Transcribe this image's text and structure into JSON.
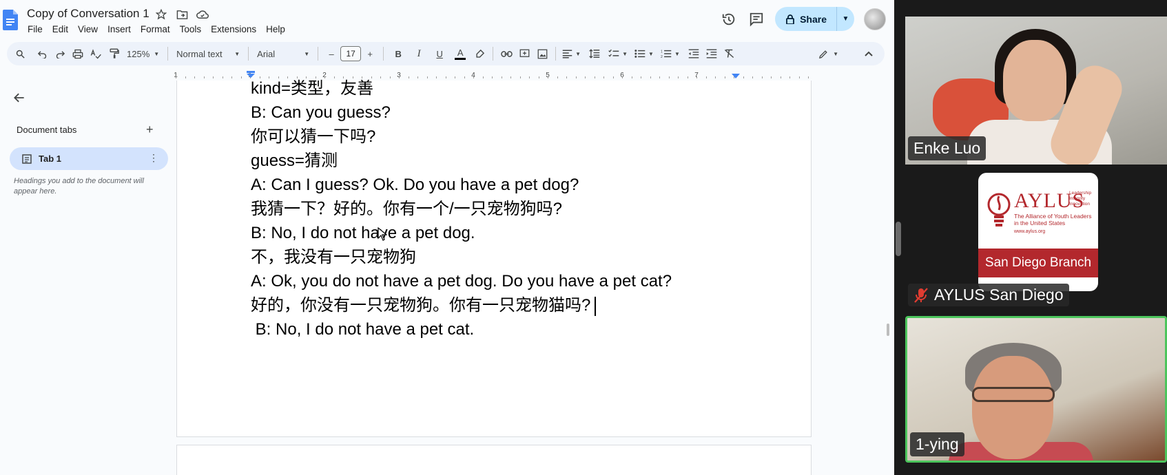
{
  "docs": {
    "title": "Copy of Conversation 1",
    "menu": [
      "File",
      "Edit",
      "View",
      "Insert",
      "Format",
      "Tools",
      "Extensions",
      "Help"
    ],
    "share_label": "Share",
    "toolbar": {
      "zoom": "125%",
      "style": "Normal text",
      "font": "Arial",
      "font_size": "17",
      "minus": "–",
      "plus": "+",
      "bold": "B",
      "italic": "I",
      "underline": "U",
      "text_color": "A"
    },
    "ruler_numbers": [
      "1",
      "1",
      "2",
      "3",
      "4",
      "5",
      "6",
      "7"
    ],
    "sidebar": {
      "title": "Document tabs",
      "tab_label": "Tab 1",
      "hint": "Headings you add to the document will appear here."
    },
    "lines": [
      "kind=类型，友善",
      "B: Can you guess?",
      "你可以猜一下吗?",
      "guess=猜测",
      "A: Can I guess? Ok. Do you have a pet dog?",
      "我猜一下？好的。你有一个/一只宠物狗吗?",
      "B: No, I do not have a pet dog.",
      "不，我没有一只宠物狗",
      "A: Ok, you do not have a pet dog. Do you have a pet cat?",
      "好的，你没有一只宠物狗。你有一只宠物猫吗?",
      " B: No, I do not have a pet cat."
    ]
  },
  "gallery": {
    "participants": [
      {
        "name": "Enke Luo",
        "active": false,
        "muted": false
      },
      {
        "name": "AYLUS San Diego",
        "active": false,
        "muted": true
      },
      {
        "name": "1-ying",
        "active": true,
        "muted": false
      }
    ],
    "aylus_card": {
      "logo": "AYLUS",
      "subtitle": "The Alliance of Youth Leaders in the United States",
      "website": "www.aylus.org",
      "motto": "Leadership Integrity Innovation",
      "branch": "San Diego Branch"
    }
  },
  "colors": {
    "share_bg": "#c2e7ff",
    "tab_active_bg": "#d3e3fd",
    "toolbar_bg": "#edf2fa",
    "active_speaker_border": "#4cc55c",
    "aylus_red": "#b3282d"
  }
}
